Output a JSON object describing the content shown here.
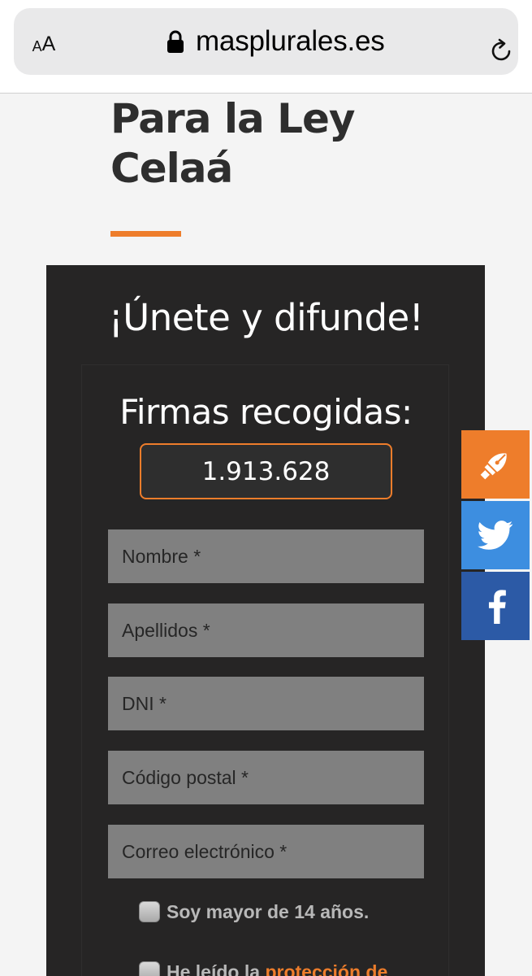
{
  "browser": {
    "text_size_small": "A",
    "text_size_large": "A",
    "url": "masplurales.es"
  },
  "page": {
    "title_line1": "Para la Ley",
    "title_line2": "Celaá",
    "accent_color": "#ee7d2b"
  },
  "form": {
    "heading": "¡Únete y difunde!",
    "counter_label": "Firmas recogidas:",
    "counter_value": "1.913.628",
    "fields": {
      "nombre": "Nombre *",
      "apellidos": "Apellidos *",
      "dni": "DNI *",
      "codigo_postal": "Código postal *",
      "email": "Correo electrónico *"
    },
    "age_check_label": "Soy mayor de 14 años.",
    "privacy_check_prefix": "He leído la ",
    "privacy_link_text": "protección de"
  },
  "share": {
    "icons": [
      "fountain-pen-icon",
      "twitter-bird-icon",
      "facebook-f-icon"
    ],
    "colors": {
      "sign": "#ee7d2b",
      "twitter": "#3d8ee0",
      "facebook": "#2c5aa6"
    }
  }
}
